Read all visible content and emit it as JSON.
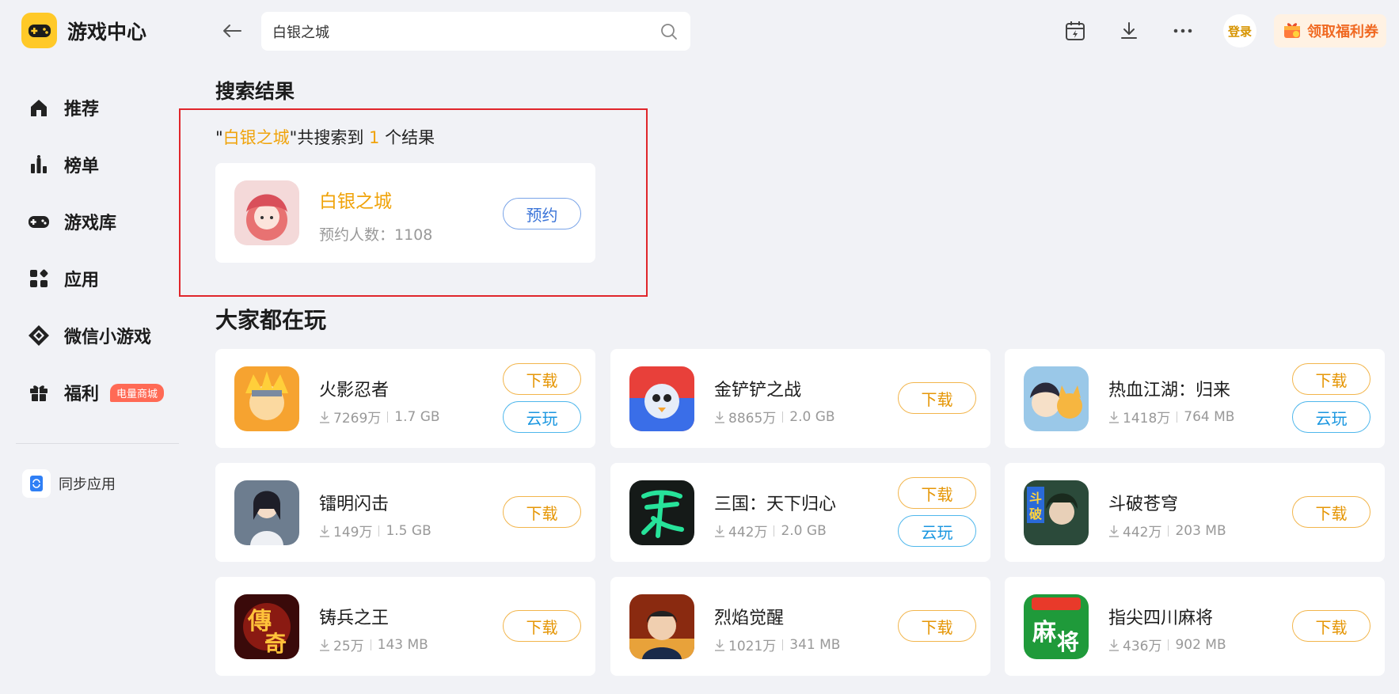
{
  "app": {
    "title": "游戏中心"
  },
  "sidebar": {
    "items": [
      {
        "label": "推荐",
        "icon": "home-icon"
      },
      {
        "label": "榜单",
        "icon": "ranking-icon"
      },
      {
        "label": "游戏库",
        "icon": "gamepad-icon"
      },
      {
        "label": "应用",
        "icon": "apps-icon"
      },
      {
        "label": "微信小游戏",
        "icon": "wechat-minigame-icon"
      },
      {
        "label": "福利",
        "icon": "gift-icon",
        "badge": "电量商城"
      }
    ],
    "sync_label": "同步应用"
  },
  "search": {
    "value": "白银之城",
    "placeholder": "白银之城"
  },
  "header": {
    "login_label": "登录",
    "coupon_label": "领取福利券"
  },
  "results": {
    "heading": "搜索结果",
    "quote_open": "\"",
    "query": "白银之城",
    "quote_close": "\"",
    "text_before_count": "共搜索到 ",
    "count": "1",
    "text_after_count": " 个结果",
    "item": {
      "title": "白银之城",
      "subtitle": "预约人数：1108",
      "button": "预约"
    }
  },
  "popular": {
    "heading": "大家都在玩",
    "download_label": "下载",
    "cloud_label": "云玩",
    "games": [
      {
        "title": "火影忍者",
        "downloads": "7269万",
        "size": "1.7 GB",
        "cloud": true
      },
      {
        "title": "金铲铲之战",
        "downloads": "8865万",
        "size": "2.0 GB",
        "cloud": false
      },
      {
        "title": "热血江湖：归来",
        "downloads": "1418万",
        "size": "764 MB",
        "cloud": true
      },
      {
        "title": "镭明闪击",
        "downloads": "149万",
        "size": "1.5 GB",
        "cloud": false
      },
      {
        "title": "三国：天下归心",
        "downloads": "442万",
        "size": "2.0 GB",
        "cloud": true
      },
      {
        "title": "斗破苍穹",
        "downloads": "442万",
        "size": "203 MB",
        "cloud": false
      },
      {
        "title": "铸兵之王",
        "downloads": "25万",
        "size": "143 MB",
        "cloud": false
      },
      {
        "title": "烈焰觉醒",
        "downloads": "1021万",
        "size": "341 MB",
        "cloud": false
      },
      {
        "title": "指尖四川麻将",
        "downloads": "436万",
        "size": "902 MB",
        "cloud": false
      }
    ]
  },
  "colors": {
    "accent": "#f0a30a",
    "reserve": "#3b74d8",
    "cloud": "#1996e0",
    "highlight_border": "#e0262b",
    "background": "#f1f2f6"
  }
}
